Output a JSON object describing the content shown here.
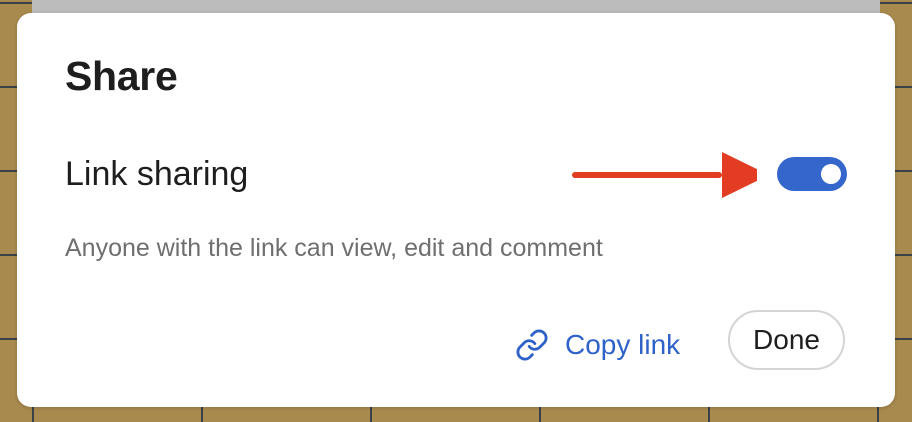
{
  "dialog": {
    "title": "Share",
    "link_sharing": {
      "label": "Link sharing",
      "enabled": true,
      "description": "Anyone with the link can view, edit and comment"
    },
    "actions": {
      "copy_link_label": "Copy link",
      "done_label": "Done"
    }
  },
  "colors": {
    "accent": "#3566cc",
    "link": "#2f62c8",
    "annotation_arrow": "#e23d22",
    "background": "#a98a4e"
  },
  "icons": {
    "copy": "link-icon",
    "annotation": "red-arrow-icon"
  }
}
